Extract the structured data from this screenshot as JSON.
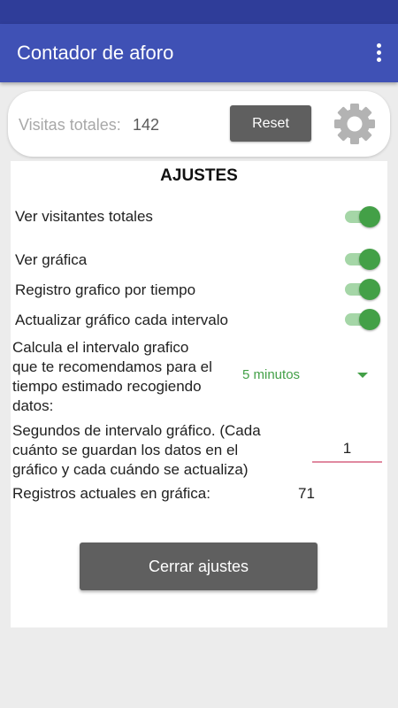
{
  "app_bar": {
    "title": "Contador de aforo"
  },
  "counter": {
    "visits_label": "Visitas totales:",
    "visits_value": "142",
    "reset_label": "Reset"
  },
  "settings": {
    "title": "AJUSTES",
    "toggles": [
      {
        "label": "Ver visitantes totales",
        "on": true
      },
      {
        "label": "Ver gráfica",
        "on": true
      },
      {
        "label": "Registro grafico por tiempo",
        "on": true
      },
      {
        "label": "Actualizar gráfico cada intervalo",
        "on": true
      }
    ],
    "interval_calc": {
      "lines": [
        "Calcula el intervalo grafico",
        "que te recomendamos para el",
        "tiempo estimado recogiendo",
        "datos:"
      ],
      "selected": "5 minutos"
    },
    "interval_seconds": {
      "lines": [
        "Segundos de intervalo gráfico. (Cada",
        "cuánto se guardan los datos en el",
        "gráfico y cada cuándo se actualiza)"
      ],
      "value": "1"
    },
    "records": {
      "label": "Registros actuales en gráfica:",
      "value": "71"
    },
    "close_label": "Cerrar ajustes"
  },
  "colors": {
    "primary": "#3f51b5",
    "primary_dark": "#2f3d99",
    "accent_green": "#43a047",
    "button_gray": "#5f5f5f"
  }
}
